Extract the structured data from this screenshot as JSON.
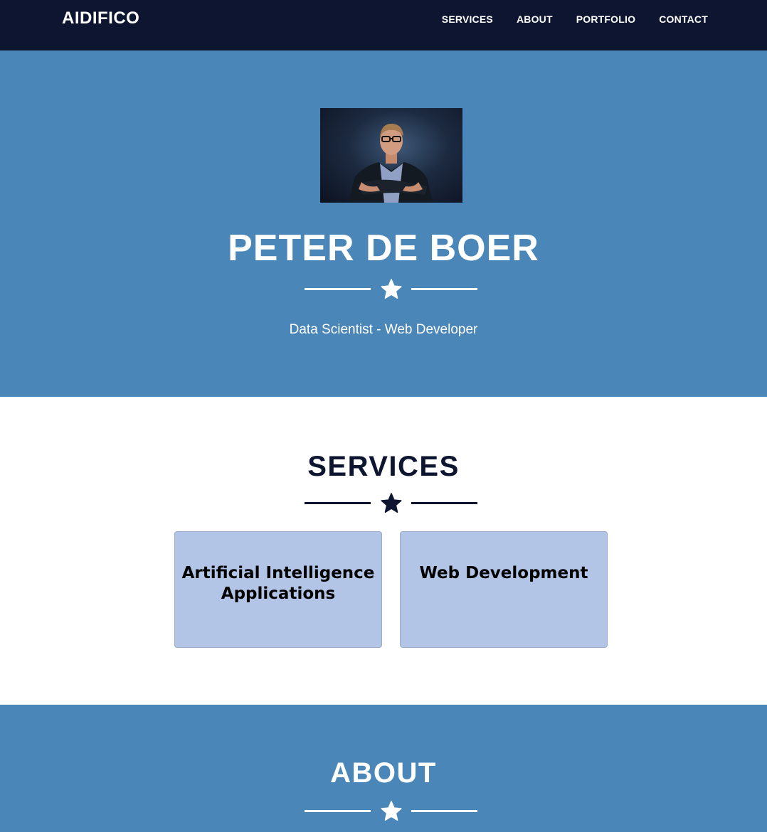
{
  "nav": {
    "brand": "AIDIFICO",
    "links": [
      "SERVICES",
      "ABOUT",
      "PORTFOLIO",
      "CONTACT"
    ]
  },
  "hero": {
    "name": "PETER DE BOER",
    "subtitle": "Data Scientist - Web Developer",
    "icon": "star-icon"
  },
  "services": {
    "title": "SERVICES",
    "cards": [
      {
        "label": "Artificial Intelligence Applications"
      },
      {
        "label": "Web Development"
      }
    ]
  },
  "about": {
    "title": "ABOUT"
  },
  "colors": {
    "navbar": "#0e1530",
    "primary": "#4a87b8",
    "dark": "#0e1530",
    "card": "#b3c5e6",
    "white": "#ffffff"
  }
}
